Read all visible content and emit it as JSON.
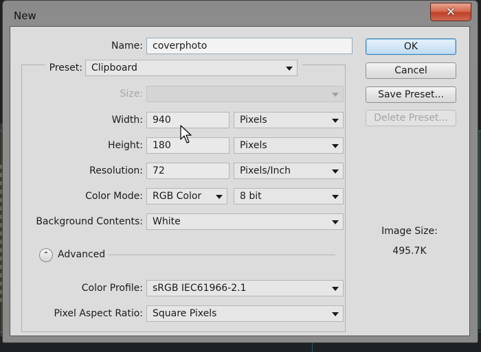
{
  "window": {
    "title": "New",
    "close_glyph": "✕"
  },
  "form": {
    "name": {
      "label": "Name:",
      "value": "coverphoto"
    },
    "preset": {
      "label": "Preset:",
      "value": "Clipboard"
    },
    "size": {
      "label": "Size:",
      "value": ""
    },
    "width": {
      "label": "Width:",
      "value": "940",
      "unit": "Pixels"
    },
    "height": {
      "label": "Height:",
      "value": "180",
      "unit": "Pixels"
    },
    "resolution": {
      "label": "Resolution:",
      "value": "72",
      "unit": "Pixels/Inch"
    },
    "color_mode": {
      "label": "Color Mode:",
      "value": "RGB Color",
      "depth": "8 bit"
    },
    "background": {
      "label": "Background Contents:",
      "value": "White"
    },
    "advanced": {
      "label": "Advanced",
      "toggle_glyph": "⌃"
    },
    "color_profile": {
      "label": "Color Profile:",
      "value": "sRGB IEC61966-2.1"
    },
    "pixel_aspect": {
      "label": "Pixel Aspect Ratio:",
      "value": "Square Pixels"
    }
  },
  "buttons": {
    "ok": "OK",
    "cancel": "Cancel",
    "save_preset": "Save Preset...",
    "delete_preset": "Delete Preset..."
  },
  "image_size": {
    "label": "Image Size:",
    "value": "495.7K"
  },
  "colors": {
    "ok_border": "#3c7fb1",
    "close_button": "#c0402a",
    "guide": "#2fa8b0"
  },
  "icons": [
    "close-icon",
    "dropdown-arrow-icon",
    "collapse-icon",
    "mouse-pointer-icon"
  ]
}
